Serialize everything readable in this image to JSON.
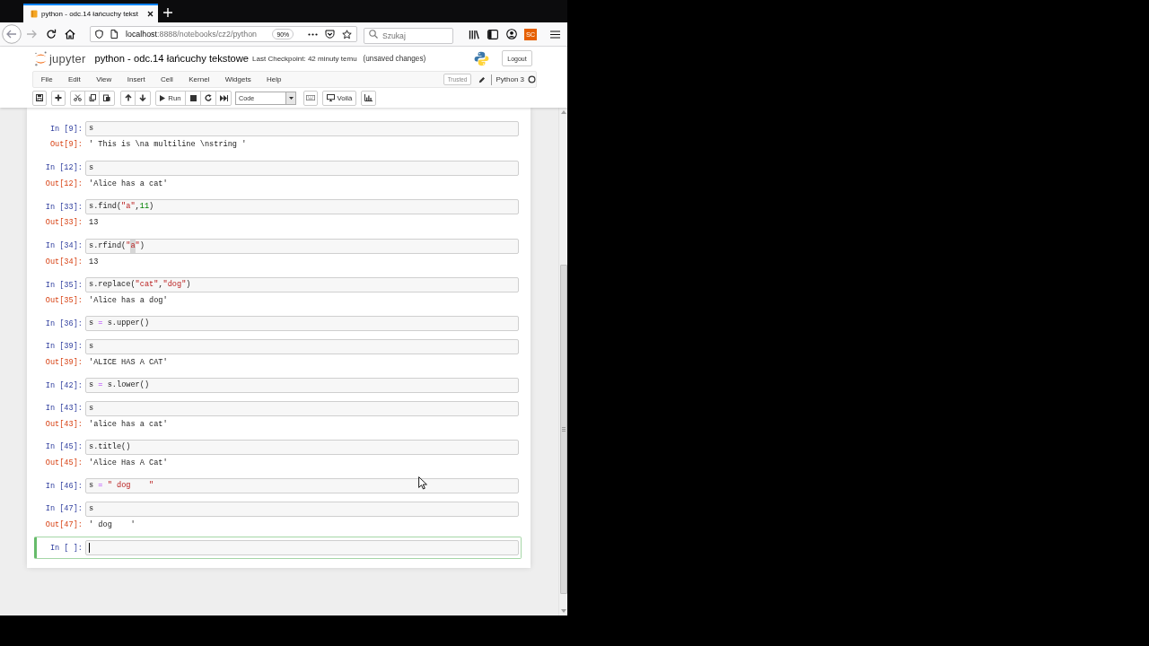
{
  "browser": {
    "tabs": [
      {
        "title": "python - odc.14 łańcuchy tekst",
        "selected": true
      }
    ],
    "address": {
      "host": "localhost",
      "path": ":8888/notebooks/cz2/python"
    },
    "zoom": "90%",
    "search": {
      "placeholder": "Szukaj"
    },
    "extension_badge": "SC"
  },
  "header": {
    "logo_text": "jupyter",
    "notebook_title": "python - odc.14 łańcuchy tekstowe",
    "checkpoint": "Last Checkpoint: 42 minuty temu",
    "save_status": "(unsaved changes)",
    "logout": "Logout"
  },
  "menubar": {
    "items": [
      "File",
      "Edit",
      "View",
      "Insert",
      "Cell",
      "Kernel",
      "Widgets",
      "Help"
    ],
    "trusted": "Trusted",
    "kernel": "Python 3",
    "kernel_busy": false
  },
  "toolbar": {
    "run": "Run",
    "cell_type": "Code",
    "voila": "Voilà"
  },
  "cells": [
    {
      "prompt": "In [9]:",
      "code": [
        {
          "text": "s",
          "kind": "name"
        }
      ],
      "output_prompt": "Out[9]:",
      "output": "' This is \\na multiline \\nstring '",
      "selected": false
    },
    {
      "prompt": "In [12]:",
      "code": [
        {
          "text": "s",
          "kind": "name"
        }
      ],
      "output_prompt": "Out[12]:",
      "output": "'Alice has a cat'",
      "selected": false
    },
    {
      "prompt": "In [33]:",
      "code": [
        {
          "text": "s.find(",
          "kind": "name"
        },
        {
          "text": "\"a\"",
          "kind": "string"
        },
        {
          "text": ",",
          "kind": "name"
        },
        {
          "text": "11",
          "kind": "number"
        },
        {
          "text": ")",
          "kind": "name"
        }
      ],
      "output_prompt": "Out[33]:",
      "output": "13",
      "selected": false
    },
    {
      "prompt": "In [34]:",
      "code": [
        {
          "text": "s.rfind(",
          "kind": "name"
        },
        {
          "text": "\"",
          "kind": "string"
        },
        {
          "text": "a",
          "kind": "marked"
        },
        {
          "text": "\"",
          "kind": "string"
        },
        {
          "text": ")",
          "kind": "name"
        }
      ],
      "output_prompt": "Out[34]:",
      "output": "13",
      "selected": false
    },
    {
      "prompt": "In [35]:",
      "code": [
        {
          "text": "s.replace(",
          "kind": "name"
        },
        {
          "text": "\"cat\"",
          "kind": "string"
        },
        {
          "text": ",",
          "kind": "name"
        },
        {
          "text": "\"dog\"",
          "kind": "string"
        },
        {
          "text": ")",
          "kind": "name"
        }
      ],
      "output_prompt": "Out[35]:",
      "output": "'Alice has a dog'",
      "selected": false
    },
    {
      "prompt": "In [36]:",
      "code": [
        {
          "text": "s",
          "kind": "name"
        },
        {
          "text": " = ",
          "kind": "operator"
        },
        {
          "text": "s.upper()",
          "kind": "name"
        }
      ],
      "selected": false
    },
    {
      "prompt": "In [39]:",
      "code": [
        {
          "text": "s",
          "kind": "name"
        }
      ],
      "output_prompt": "Out[39]:",
      "output": "'ALICE HAS A CAT'",
      "selected": false
    },
    {
      "prompt": "In [42]:",
      "code": [
        {
          "text": "s",
          "kind": "name"
        },
        {
          "text": " = ",
          "kind": "operator"
        },
        {
          "text": "s.lower()",
          "kind": "name"
        }
      ],
      "selected": false
    },
    {
      "prompt": "In [43]:",
      "code": [
        {
          "text": "s",
          "kind": "name"
        }
      ],
      "output_prompt": "Out[43]:",
      "output": "'alice has a cat'",
      "selected": false
    },
    {
      "prompt": "In [45]:",
      "code": [
        {
          "text": "s.title()",
          "kind": "name"
        }
      ],
      "output_prompt": "Out[45]:",
      "output": "'Alice Has A Cat'",
      "selected": false
    },
    {
      "prompt": "In [46]:",
      "code": [
        {
          "text": "s",
          "kind": "name"
        },
        {
          "text": " = ",
          "kind": "operator"
        },
        {
          "text": "\" dog    \"",
          "kind": "string"
        }
      ],
      "selected": false
    },
    {
      "prompt": "In [47]:",
      "code": [
        {
          "text": "s",
          "kind": "name"
        }
      ],
      "output_prompt": "Out[47]:",
      "output": "' dog    '",
      "selected": false
    },
    {
      "prompt": "In [ ]:",
      "selected": true
    }
  ]
}
